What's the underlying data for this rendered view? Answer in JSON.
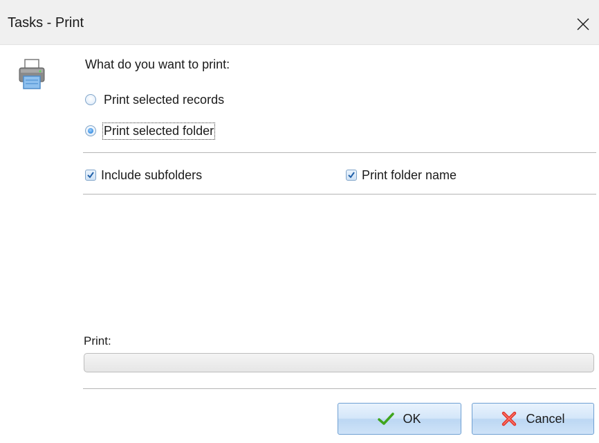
{
  "window": {
    "title": "Tasks - Print"
  },
  "icons": {
    "close": "close-icon",
    "printer": "printer-icon",
    "ok": "checkmark-icon",
    "cancel": "red-x-icon"
  },
  "prompt": {
    "question": "What do you want to print:"
  },
  "options": {
    "radios": [
      {
        "label": "Print selected records",
        "checked": false
      },
      {
        "label": "Print selected folder",
        "checked": true
      }
    ],
    "include_subfolders": {
      "label": "Include subfolders",
      "checked": true
    },
    "print_folder_name": {
      "label": "Print folder name",
      "checked": true
    }
  },
  "progress": {
    "label": "Print:",
    "value": 0
  },
  "buttons": {
    "ok": "OK",
    "cancel": "Cancel"
  },
  "colors": {
    "accent": "#3a8fe0",
    "cancel_icon": "#e0342a",
    "ok_icon": "#3fa51d"
  }
}
